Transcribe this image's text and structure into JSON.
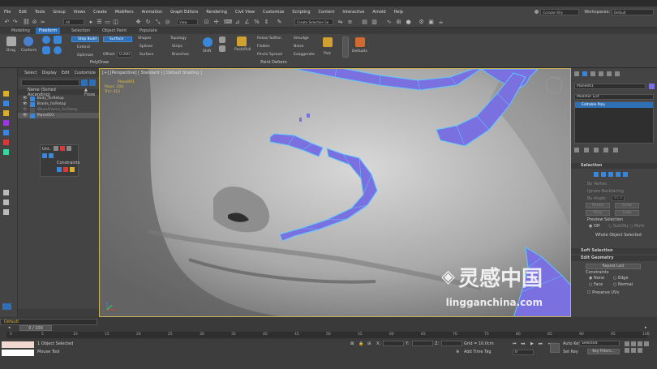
{
  "menubar": {
    "items": [
      "File",
      "Edit",
      "Tools",
      "Group",
      "Views",
      "Create",
      "Modifiers",
      "Animation",
      "Graph Editors",
      "Rendering",
      "Civil View",
      "Customize",
      "Scripting",
      "Content",
      "Interactive",
      "Arnold",
      "Help"
    ],
    "user": "Corazon Bry",
    "workspaces_label": "Workspaces:",
    "workspace_value": "Default"
  },
  "toolbar": {
    "selection_filter": "All",
    "view_dropdown": "View",
    "create_selection_set": "Create Selection Se"
  },
  "ribbon": {
    "tabs": [
      "Modeling",
      "Freeform",
      "Selection",
      "Object Paint",
      "Populate"
    ],
    "active_tab": "Freeform",
    "tools": {
      "drag": "Drag",
      "conform": "Conform",
      "step_build": "Step Build",
      "extend": "Extend",
      "optimize": "Optimize",
      "surface": "Surface",
      "offset_label": "Offset:",
      "offset_value": "0.200",
      "shapes": "Shapes",
      "splines": "Splines",
      "surface2": "Surface",
      "topology": "Topology",
      "strips": "Strips",
      "branches": "Branches",
      "shift": "Shift",
      "push_pull": "Push/Pull",
      "relax_soften": "Relax/ Soften",
      "flatten": "Flatten",
      "pinch_spread": "Pinch/ Spread",
      "smudge": "Smudge",
      "noise": "Noise",
      "exaggerate": "Exaggerate",
      "pick": "Pick",
      "defaults": "Defaults"
    },
    "sections": {
      "polydraw": "PolyDraw",
      "paint_deform": "Paint Deform"
    }
  },
  "scene": {
    "menu": [
      "Select",
      "Display",
      "Edit",
      "Customize"
    ],
    "column_header": "Name (Sorted Ascending)",
    "frozen_header": "▲ Froze",
    "items": [
      "Body_forRetop",
      "Braids_forRetop",
      "WaveArmors_forRetop",
      "Plane001"
    ]
  },
  "freeform_panel": {
    "title": "Uni..",
    "constraints": "Constraints"
  },
  "viewport": {
    "label": "[+] [Perspective] [ Standard ] [ Default Shading ]",
    "object_name": "Plane001",
    "polys_label": "Polys:",
    "polys_value": "356",
    "tris_label": "Tris:",
    "tris_value": "412"
  },
  "command_panel": {
    "object_name": "Plane001",
    "modifier_list": "Modifier List",
    "stack_item": "Editable Poly",
    "selection_rollout": "Selection",
    "by_vertex": "By Vertex",
    "ignore_backfacing": "Ignore Backfacing",
    "by_angle": "By Angle:",
    "by_angle_value": "45.0",
    "shrink": "Shrink",
    "grow": "Grow",
    "ring": "Ring",
    "loop": "Loop",
    "preview_selection": "Preview Selection",
    "off": "Off",
    "subobj": "SubObj",
    "multi": "Multi",
    "whole_object_selected": "Whole Object Selected",
    "soft_selection": "Soft Selection",
    "edit_geometry": "Edit Geometry",
    "repeat_last": "Repeat Last",
    "constraints": "Constraints",
    "none": "None",
    "edge": "Edge",
    "face": "Face",
    "normal": "Normal",
    "preserve_uvs": "Preserve UVs"
  },
  "timeline": {
    "frame_display": "0 / 100",
    "ticks": [
      "0",
      "5",
      "10",
      "15",
      "20",
      "25",
      "30",
      "35",
      "40",
      "45",
      "50",
      "55",
      "60",
      "65",
      "70",
      "75",
      "80",
      "85",
      "90",
      "95",
      "100"
    ]
  },
  "statusbar": {
    "layer": "Default",
    "objects_selected": "1 Object Selected",
    "prompt": "Mouse Tool",
    "x_label": "X:",
    "y_label": "Y:",
    "z_label": "Z:",
    "grid": "Grid = 10.0cm",
    "add_time_tag": "Add Time Tag",
    "auto_key": "Auto Key",
    "selected": "Selected",
    "set_key": "Set Key",
    "key_filters": "Key Filters...",
    "frame": "0"
  },
  "watermark": {
    "cn": "灵感中国",
    "url": "lingganchina.com"
  },
  "colors": {
    "accent": "#2f6fb5",
    "poly_fill": "#7a70e0",
    "poly_edge": "#5ec8ff",
    "viewport_border": "#c8b25a",
    "frozen": "#8a8a8a"
  }
}
